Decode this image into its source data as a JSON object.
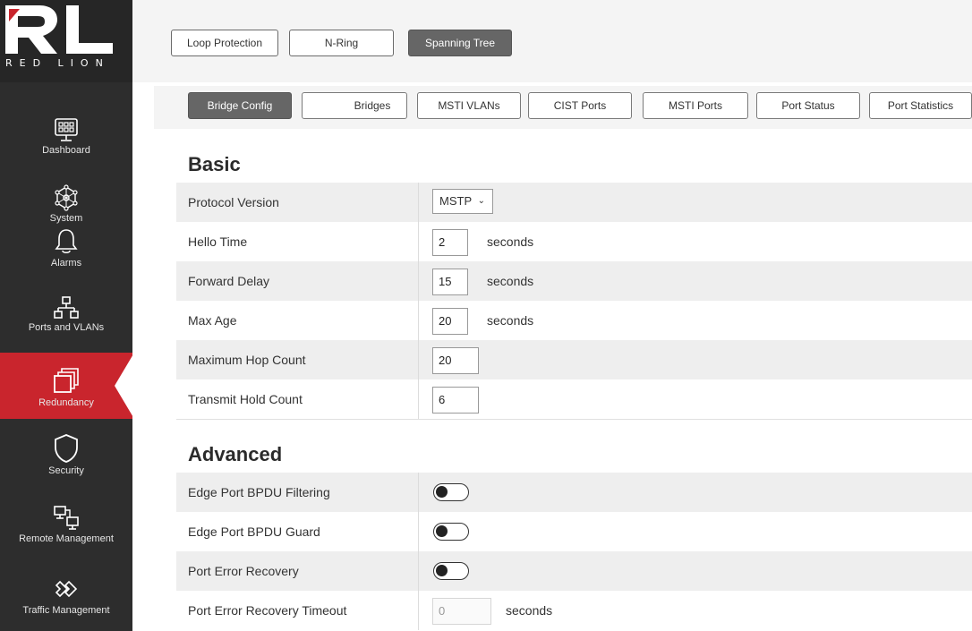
{
  "brand": {
    "logo_text": "RL",
    "tagline": "RED LION"
  },
  "sidebar": {
    "items": [
      {
        "label": "Dashboard",
        "icon": "dashboard-icon"
      },
      {
        "label": "System",
        "icon": "system-network-icon"
      },
      {
        "label": "Alarms",
        "icon": "bell-icon"
      },
      {
        "label": "Ports and VLANs",
        "icon": "network-ports-icon"
      },
      {
        "label": "Redundancy",
        "icon": "redundancy-windows-icon"
      },
      {
        "label": "Security",
        "icon": "shield-icon"
      },
      {
        "label": "Remote Management",
        "icon": "remote-management-icon"
      },
      {
        "label": "Traffic Management",
        "icon": "double-chevron-icon"
      }
    ],
    "active": "Redundancy"
  },
  "top_tabs": [
    "Loop Protection",
    "N-Ring",
    "Spanning Tree"
  ],
  "top_tab_active": "Spanning Tree",
  "sub_tabs": [
    "Bridge Config",
    "Bridges",
    "MSTI VLANs",
    "CIST Ports",
    "MSTI Ports",
    "Port Status",
    "Port Statistics"
  ],
  "sub_tab_active": "Bridge Config",
  "basic": {
    "title": "Basic",
    "protocol_version": {
      "label": "Protocol Version",
      "value": "MSTP"
    },
    "hello_time": {
      "label": "Hello Time",
      "value": "2",
      "unit": "seconds"
    },
    "forward_delay": {
      "label": "Forward Delay",
      "value": "15",
      "unit": "seconds"
    },
    "max_age": {
      "label": "Max Age",
      "value": "20",
      "unit": "seconds"
    },
    "max_hop_count": {
      "label": "Maximum Hop Count",
      "value": "20"
    },
    "transmit_hold_count": {
      "label": "Transmit Hold Count",
      "value": "6"
    }
  },
  "advanced": {
    "title": "Advanced",
    "edge_bpdu_filtering": {
      "label": "Edge Port BPDU Filtering",
      "enabled": false
    },
    "edge_bpdu_guard": {
      "label": "Edge Port BPDU Guard",
      "enabled": false
    },
    "port_error_recovery": {
      "label": "Port Error Recovery",
      "enabled": false
    },
    "port_error_recovery_timeout": {
      "label": "Port Error Recovery Timeout",
      "value": "0",
      "unit": "seconds"
    }
  },
  "colors": {
    "accent_red": "#c9252d",
    "sidebar_bg": "#2d2d2d",
    "active_tab": "#666666"
  }
}
